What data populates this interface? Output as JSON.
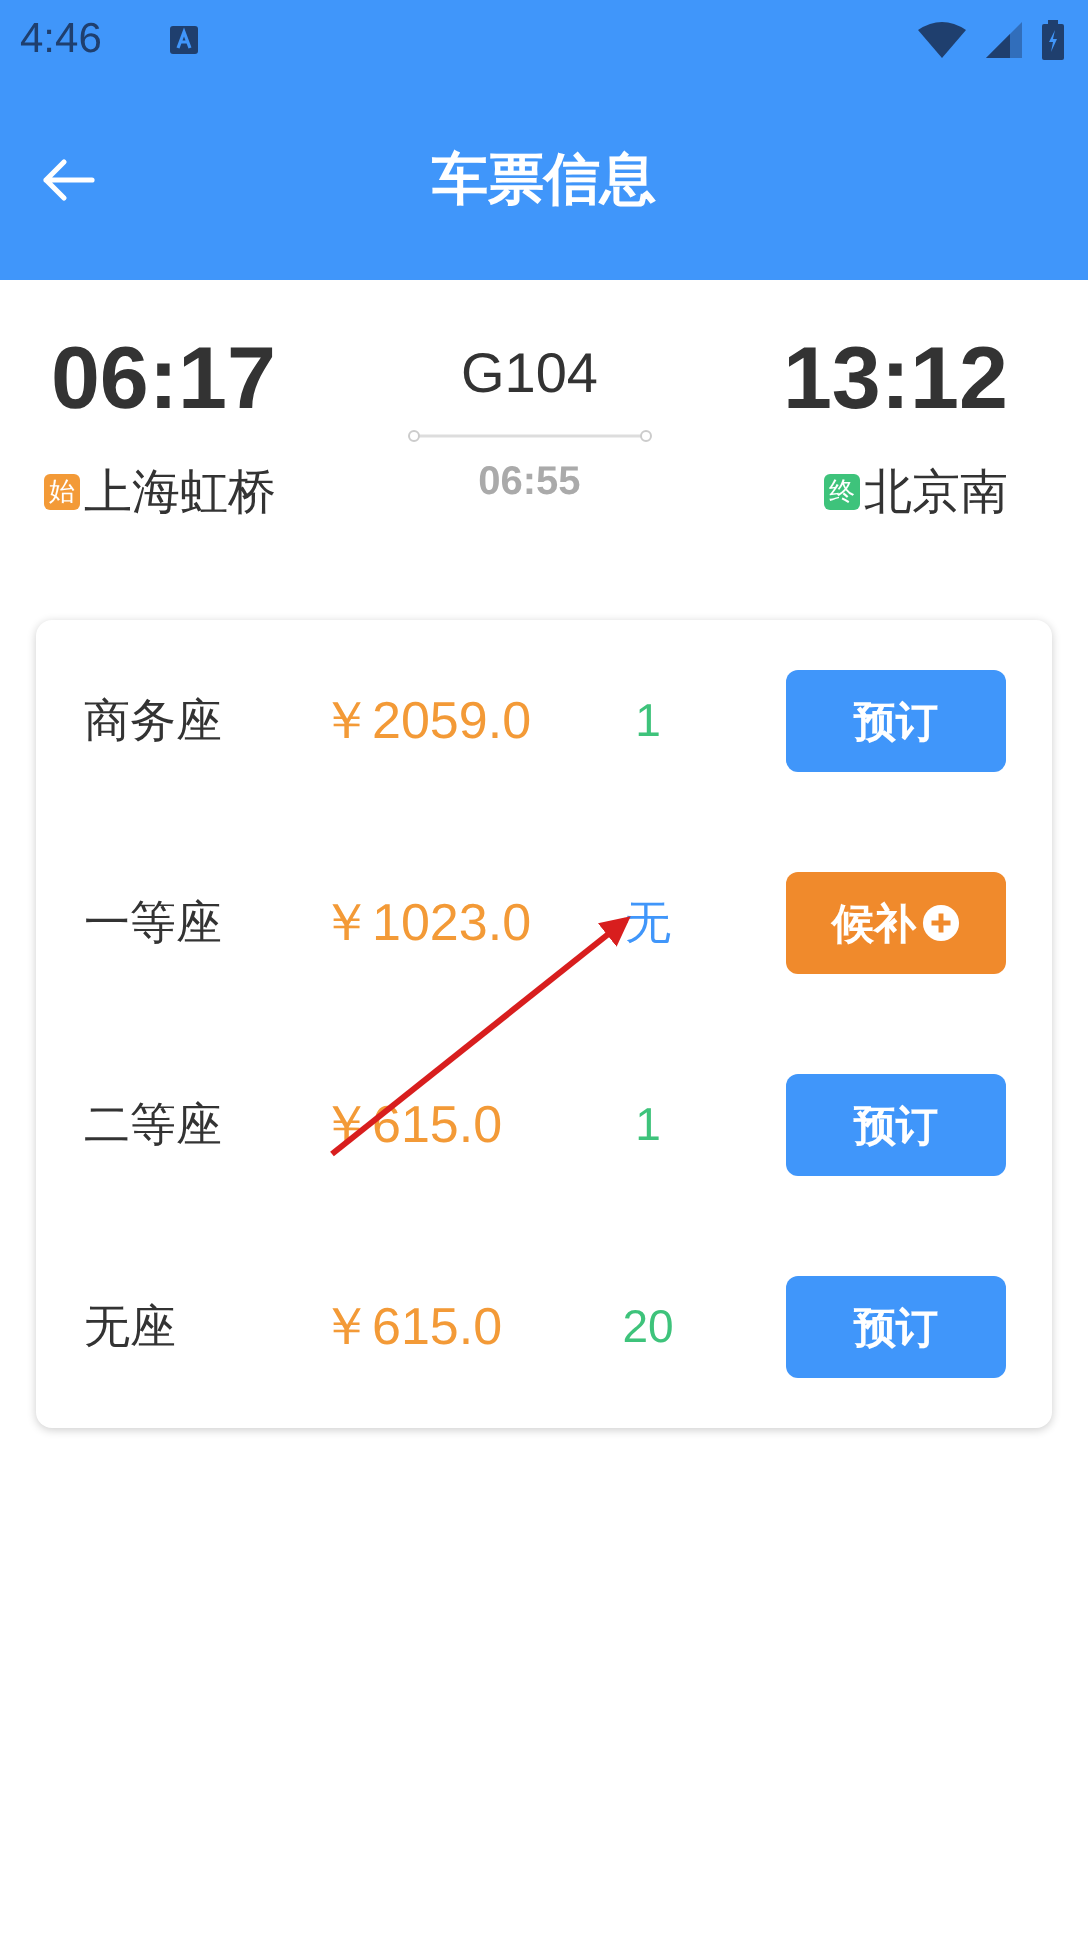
{
  "status_bar": {
    "time": "4:46"
  },
  "app_bar": {
    "title": "车票信息"
  },
  "train": {
    "depart_time": "06:17",
    "arrive_time": "13:12",
    "number": "G104",
    "duration": "06:55",
    "from_badge": "始",
    "from_station": "上海虹桥",
    "to_badge": "终",
    "to_station": "北京南"
  },
  "seats": [
    {
      "name": "商务座",
      "price": "￥2059.0",
      "count": "1",
      "available": true,
      "kind": "book",
      "button": "预订"
    },
    {
      "name": "一等座",
      "price": "￥1023.0",
      "count": "无",
      "available": false,
      "kind": "waitlist",
      "button": "候补"
    },
    {
      "name": "二等座",
      "price": "￥615.0",
      "count": "1",
      "available": true,
      "kind": "book",
      "button": "预订"
    },
    {
      "name": "无座",
      "price": "￥615.0",
      "count": "20",
      "available": true,
      "kind": "book",
      "button": "预订"
    }
  ],
  "annotation": {
    "kind": "arrow"
  }
}
